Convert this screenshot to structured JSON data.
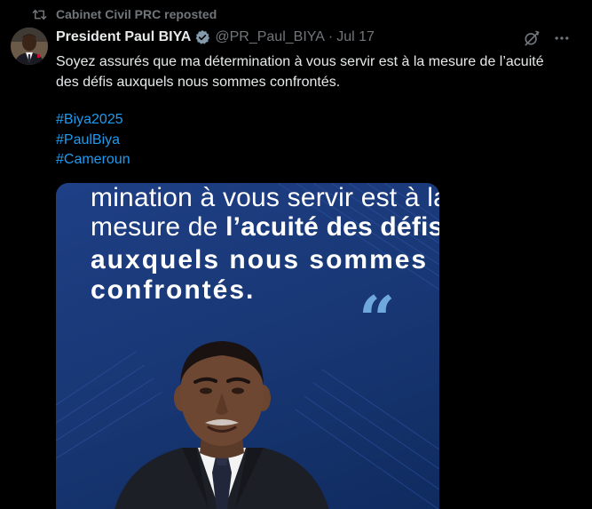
{
  "repost": {
    "label": "Cabinet Civil PRC reposted",
    "icon": "repost-icon"
  },
  "author": {
    "display_name": "President Paul BIYA",
    "handle": "@PR_Paul_BIYA",
    "separator": "·",
    "date": "Jul 17",
    "verified_icon": "verified-badge-icon"
  },
  "actions": {
    "grok_icon": "grok-icon",
    "more_icon": "more-icon"
  },
  "body": {
    "text": "Soyez assurés que ma détermination à vous servir est à la mesure de l’acuité des défis auxquels nous sommes confrontés."
  },
  "hashtags": [
    "#Biya2025",
    "#PaulBiya",
    "#Cameroun"
  ],
  "media": {
    "line1": "mination à vous servir est à la",
    "line2_regular": "mesure de ",
    "line2_bold": "l’acuité des défis",
    "line3": "auxquels nous sommes",
    "line4": "confrontés.",
    "quote_mark": "“"
  },
  "colors": {
    "background": "#000000",
    "text": "#e7e9ea",
    "muted": "#71767b",
    "link": "#1d9bf0",
    "verified": "#829aab",
    "media_bg": "#1a3a7a",
    "quote_mark": "#6fa8dc"
  }
}
